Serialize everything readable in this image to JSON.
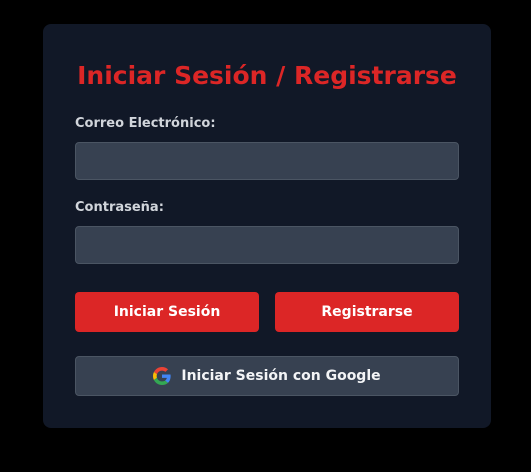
{
  "form": {
    "title": "Iniciar Sesión / Registrarse",
    "email_label": "Correo Electrónico:",
    "email_value": "",
    "password_label": "Contraseña:",
    "password_value": "",
    "login_button": "Iniciar Sesión",
    "register_button": "Registrarse",
    "google_button": "Iniciar Sesión con Google",
    "google_icon": "google-icon"
  },
  "colors": {
    "background": "#000000",
    "card": "#111827",
    "accent": "#dc2626",
    "input": "#374151",
    "label": "#d1d5db"
  }
}
